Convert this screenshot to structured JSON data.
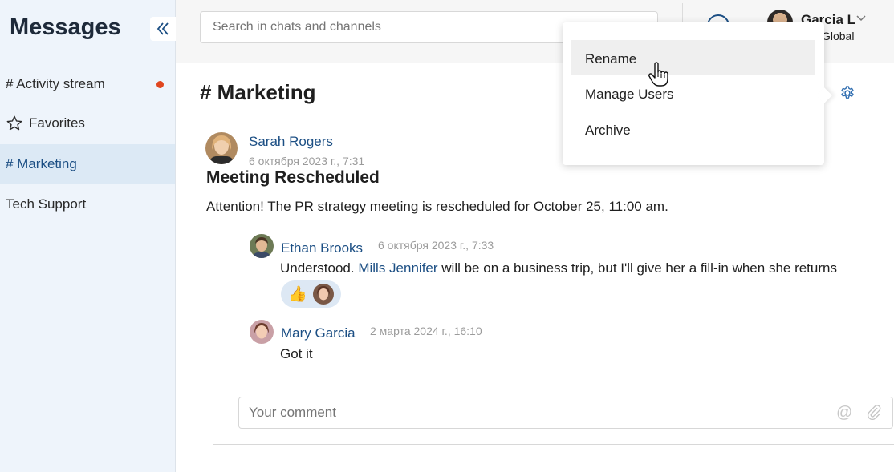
{
  "sidebar": {
    "title": "Messages",
    "items": [
      {
        "label": "# Activity stream",
        "unread": true
      },
      {
        "label": "Favorites"
      },
      {
        "label": "# Marketing",
        "active": true
      },
      {
        "label": "Tech Support"
      }
    ]
  },
  "header": {
    "search_placeholder": "Search in chats and channels",
    "user_name": "Garcia L",
    "user_company": "P Global"
  },
  "channel": {
    "title": "# Marketing"
  },
  "post": {
    "author": "Sarah Rogers",
    "date": "6 октября 2023 г., 7:31",
    "subject": "Meeting Rescheduled",
    "text": "Attention! The PR strategy meeting is rescheduled for October 25, 11:00 am."
  },
  "replies": [
    {
      "author": "Ethan Brooks",
      "date": "6 октября 2023 г., 7:33",
      "text_before": "Understood. ",
      "mention": "Mills Jennifer",
      "text_after": " will be on a business trip, but I'll give her a fill-in when she returns",
      "reaction": "👍"
    },
    {
      "author": "Mary Garcia",
      "date": "2 марта 2024 г., 16:10",
      "text": "Got it"
    }
  ],
  "comment": {
    "placeholder": "Your comment"
  },
  "dropdown": {
    "items": [
      "Rename",
      "Manage Users",
      "Archive"
    ]
  },
  "colors": {
    "accent": "#1c4f84",
    "sidebar_bg": "#eef4fb",
    "active_bg": "#dce9f5",
    "unread_dot": "#e0461f"
  },
  "icons": [
    "collapse-icon",
    "star-icon",
    "help-icon",
    "chevron-down-icon",
    "gear-icon",
    "at-icon",
    "paperclip-icon",
    "hand-cursor-icon"
  ]
}
